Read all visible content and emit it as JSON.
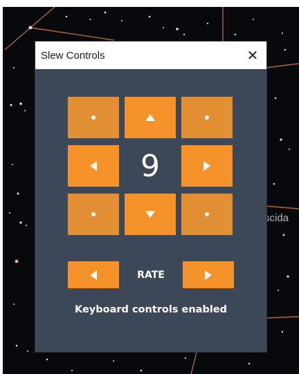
{
  "window": {
    "title": "Slew Controls",
    "close_icon": "close-icon"
  },
  "pad": {
    "up_icon": "arrow-up-icon",
    "down_icon": "arrow-down-icon",
    "left_icon": "arrow-left-icon",
    "right_icon": "arrow-right-icon",
    "diagonal_icon": "dot-icon",
    "rate_value": "9"
  },
  "rate": {
    "label": "RATE",
    "decrease_icon": "arrow-left-icon",
    "increase_icon": "arrow-right-icon"
  },
  "status": {
    "keyboard": "Keyboard controls enabled"
  },
  "background": {
    "partial_label": "scida"
  },
  "colors": {
    "accent": "#f5932a",
    "accent_diagonal": "#e28f34",
    "panel": "#3c4757",
    "sky": "#08090c",
    "constellation_line": "#b5673a"
  }
}
